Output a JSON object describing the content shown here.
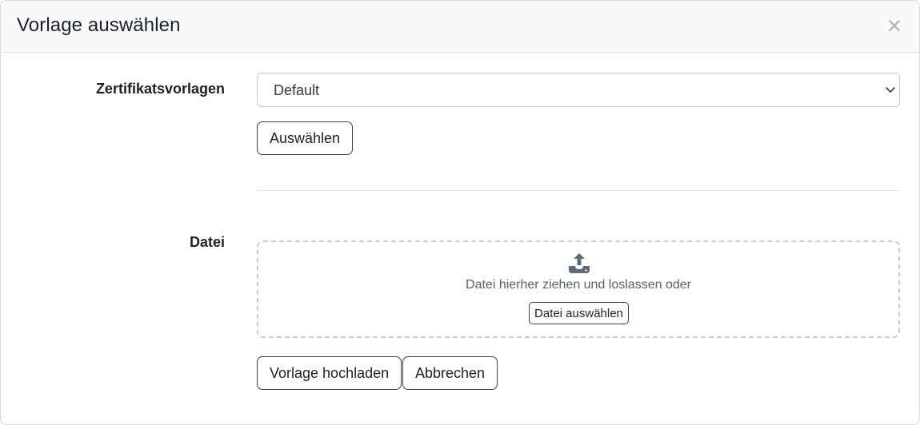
{
  "dialog": {
    "title": "Vorlage auswählen",
    "close_symbol": "×"
  },
  "template_field": {
    "label": "Zertifikatsvorlagen",
    "selected_value": "Default",
    "select_button_label": "Auswählen"
  },
  "file_field": {
    "label": "Datei",
    "dropzone_text": "Datei hierher ziehen und loslassen oder",
    "choose_file_label": "Datei auswählen",
    "icon": "upload-icon"
  },
  "footer": {
    "upload_button_label": "Vorlage hochladen",
    "cancel_button_label": "Abbrechen"
  }
}
